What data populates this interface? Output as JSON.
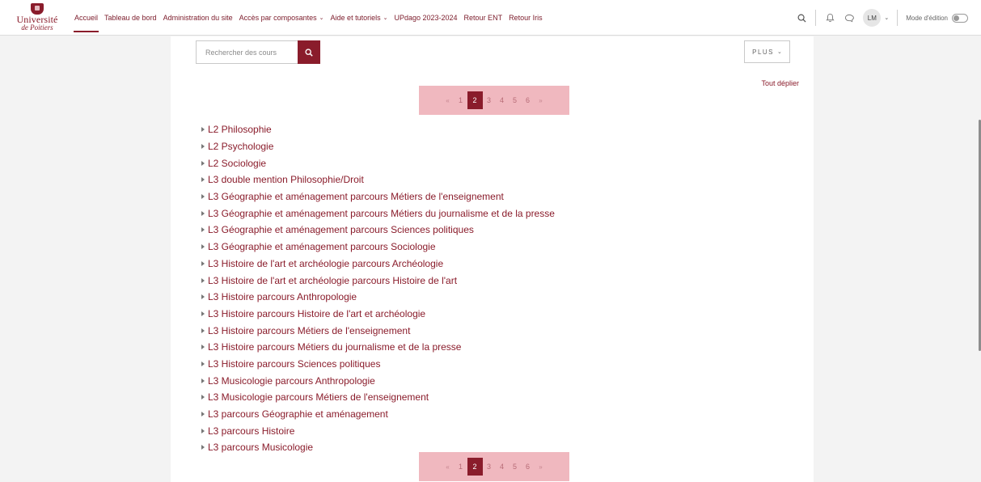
{
  "logo": {
    "line1": "Université",
    "line2": "de Poitiers"
  },
  "nav": {
    "items": [
      {
        "label": "Accueil",
        "dropdown": false,
        "active": true
      },
      {
        "label": "Tableau de bord",
        "dropdown": false
      },
      {
        "label": "Administration du site",
        "dropdown": false
      },
      {
        "label": "Accès par composantes",
        "dropdown": true
      },
      {
        "label": "Aide et tutoriels",
        "dropdown": true
      },
      {
        "label": "UPdago 2023-2024",
        "dropdown": false
      },
      {
        "label": "Retour ENT",
        "dropdown": false
      },
      {
        "label": "Retour Iris",
        "dropdown": false
      }
    ]
  },
  "user": {
    "initials": "LM"
  },
  "edit_mode": {
    "label": "Mode d'édition",
    "enabled": false
  },
  "search": {
    "placeholder": "Rechercher des cours"
  },
  "more_button": {
    "label": "PLUS"
  },
  "expand_all": {
    "label": "Tout déplier"
  },
  "pagination": {
    "prev": "«",
    "next": "»",
    "pages": [
      "1",
      "2",
      "3",
      "4",
      "5",
      "6"
    ],
    "current": "2"
  },
  "courses": [
    "L2 Philosophie",
    "L2 Psychologie",
    "L2 Sociologie",
    "L3 double mention Philosophie/Droit",
    "L3 Géographie et aménagement parcours Métiers de l'enseignement",
    "L3 Géographie et aménagement parcours Métiers du journalisme et de la presse",
    "L3 Géographie et aménagement parcours Sciences politiques",
    "L3 Géographie et aménagement parcours Sociologie",
    "L3 Histoire de l'art et archéologie parcours Archéologie",
    "L3 Histoire de l'art et archéologie parcours Histoire de l'art",
    "L3 Histoire parcours Anthropologie",
    "L3 Histoire parcours Histoire de l'art et archéologie",
    "L3 Histoire parcours Métiers de l'enseignement",
    "L3 Histoire parcours Métiers du journalisme et de la presse",
    "L3 Histoire parcours Sciences politiques",
    "L3 Musicologie parcours Anthropologie",
    "L3 Musicologie parcours Métiers de l'enseignement",
    "L3 parcours Géographie et aménagement",
    "L3 parcours Histoire",
    "L3 parcours Musicologie"
  ],
  "colors": {
    "brand": "#8a1c2b",
    "pager_bg": "#f0b8bf"
  }
}
